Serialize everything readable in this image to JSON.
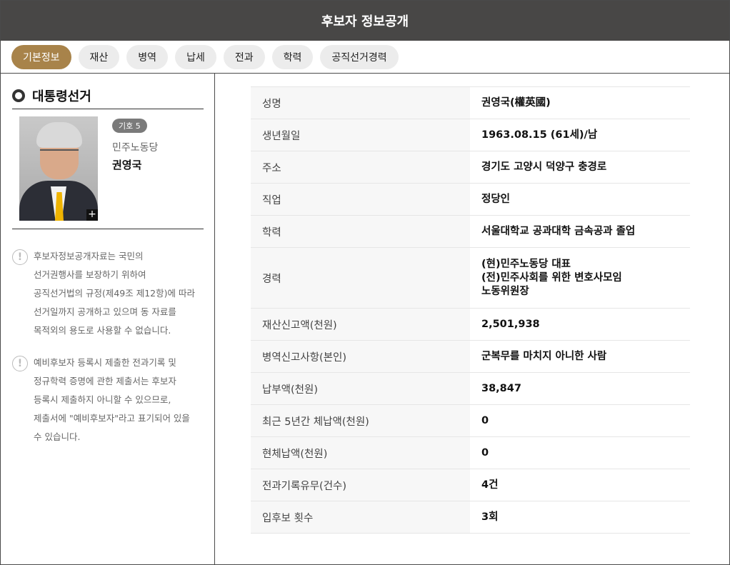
{
  "header": {
    "title": "후보자 정보공개"
  },
  "tabs": [
    "기본정보",
    "재산",
    "병역",
    "납세",
    "전과",
    "학력",
    "공직선거경력"
  ],
  "active_tab": 0,
  "section": {
    "title": "대통령선거"
  },
  "candidate": {
    "number_badge": "기호 5",
    "party": "민주노동당",
    "name": "권영국",
    "photo_zoom": "+"
  },
  "notices": [
    {
      "icon": "!",
      "lines": [
        "후보자정보공개자료는 국민의",
        "선거권행사를 보장하기 위하여",
        "공직선거법의 규정(제49조 제12항)에 따라",
        "선거일까지 공개하고 있으며 동 자료를",
        "목적외의 용도로 사용할 수 없습니다."
      ]
    },
    {
      "icon": "!",
      "lines": [
        "예비후보자 등록시 제출한 전과기록 및",
        "정규학력 증명에 관한 제출서는 후보자",
        "등록시 제출하지 아니할 수 있으므로,",
        "제출서에 \"예비후보자\"라고 표기되어 있을",
        "수 있습니다."
      ]
    }
  ],
  "info": [
    {
      "label": "성명",
      "value": [
        "권영국(權英國)"
      ]
    },
    {
      "label": "생년월일",
      "value": [
        "1963.08.15 (61세)/남"
      ]
    },
    {
      "label": "주소",
      "value": [
        "경기도 고양시 덕양구 충경로"
      ]
    },
    {
      "label": "직업",
      "value": [
        "정당인"
      ]
    },
    {
      "label": "학력",
      "value": [
        "서울대학교 공과대학 금속공과 졸업"
      ]
    },
    {
      "label": "경력",
      "value": [
        "(현)민주노동당 대표",
        "(전)민주사회를 위한 변호사모임",
        "노동위원장"
      ]
    },
    {
      "label": "재산신고액(천원)",
      "value": [
        "2,501,938"
      ]
    },
    {
      "label": "병역신고사항(본인)",
      "value": [
        "군복무를 마치지 아니한 사람"
      ]
    },
    {
      "label": "납부액(천원)",
      "value": [
        "38,847"
      ]
    },
    {
      "label": "최근 5년간 체납액(천원)",
      "value": [
        "0"
      ]
    },
    {
      "label": "현체납액(천원)",
      "value": [
        "0"
      ]
    },
    {
      "label": "전과기록유무(건수)",
      "value": [
        "4건"
      ]
    },
    {
      "label": "입후보 횟수",
      "value": [
        "3회"
      ]
    }
  ]
}
